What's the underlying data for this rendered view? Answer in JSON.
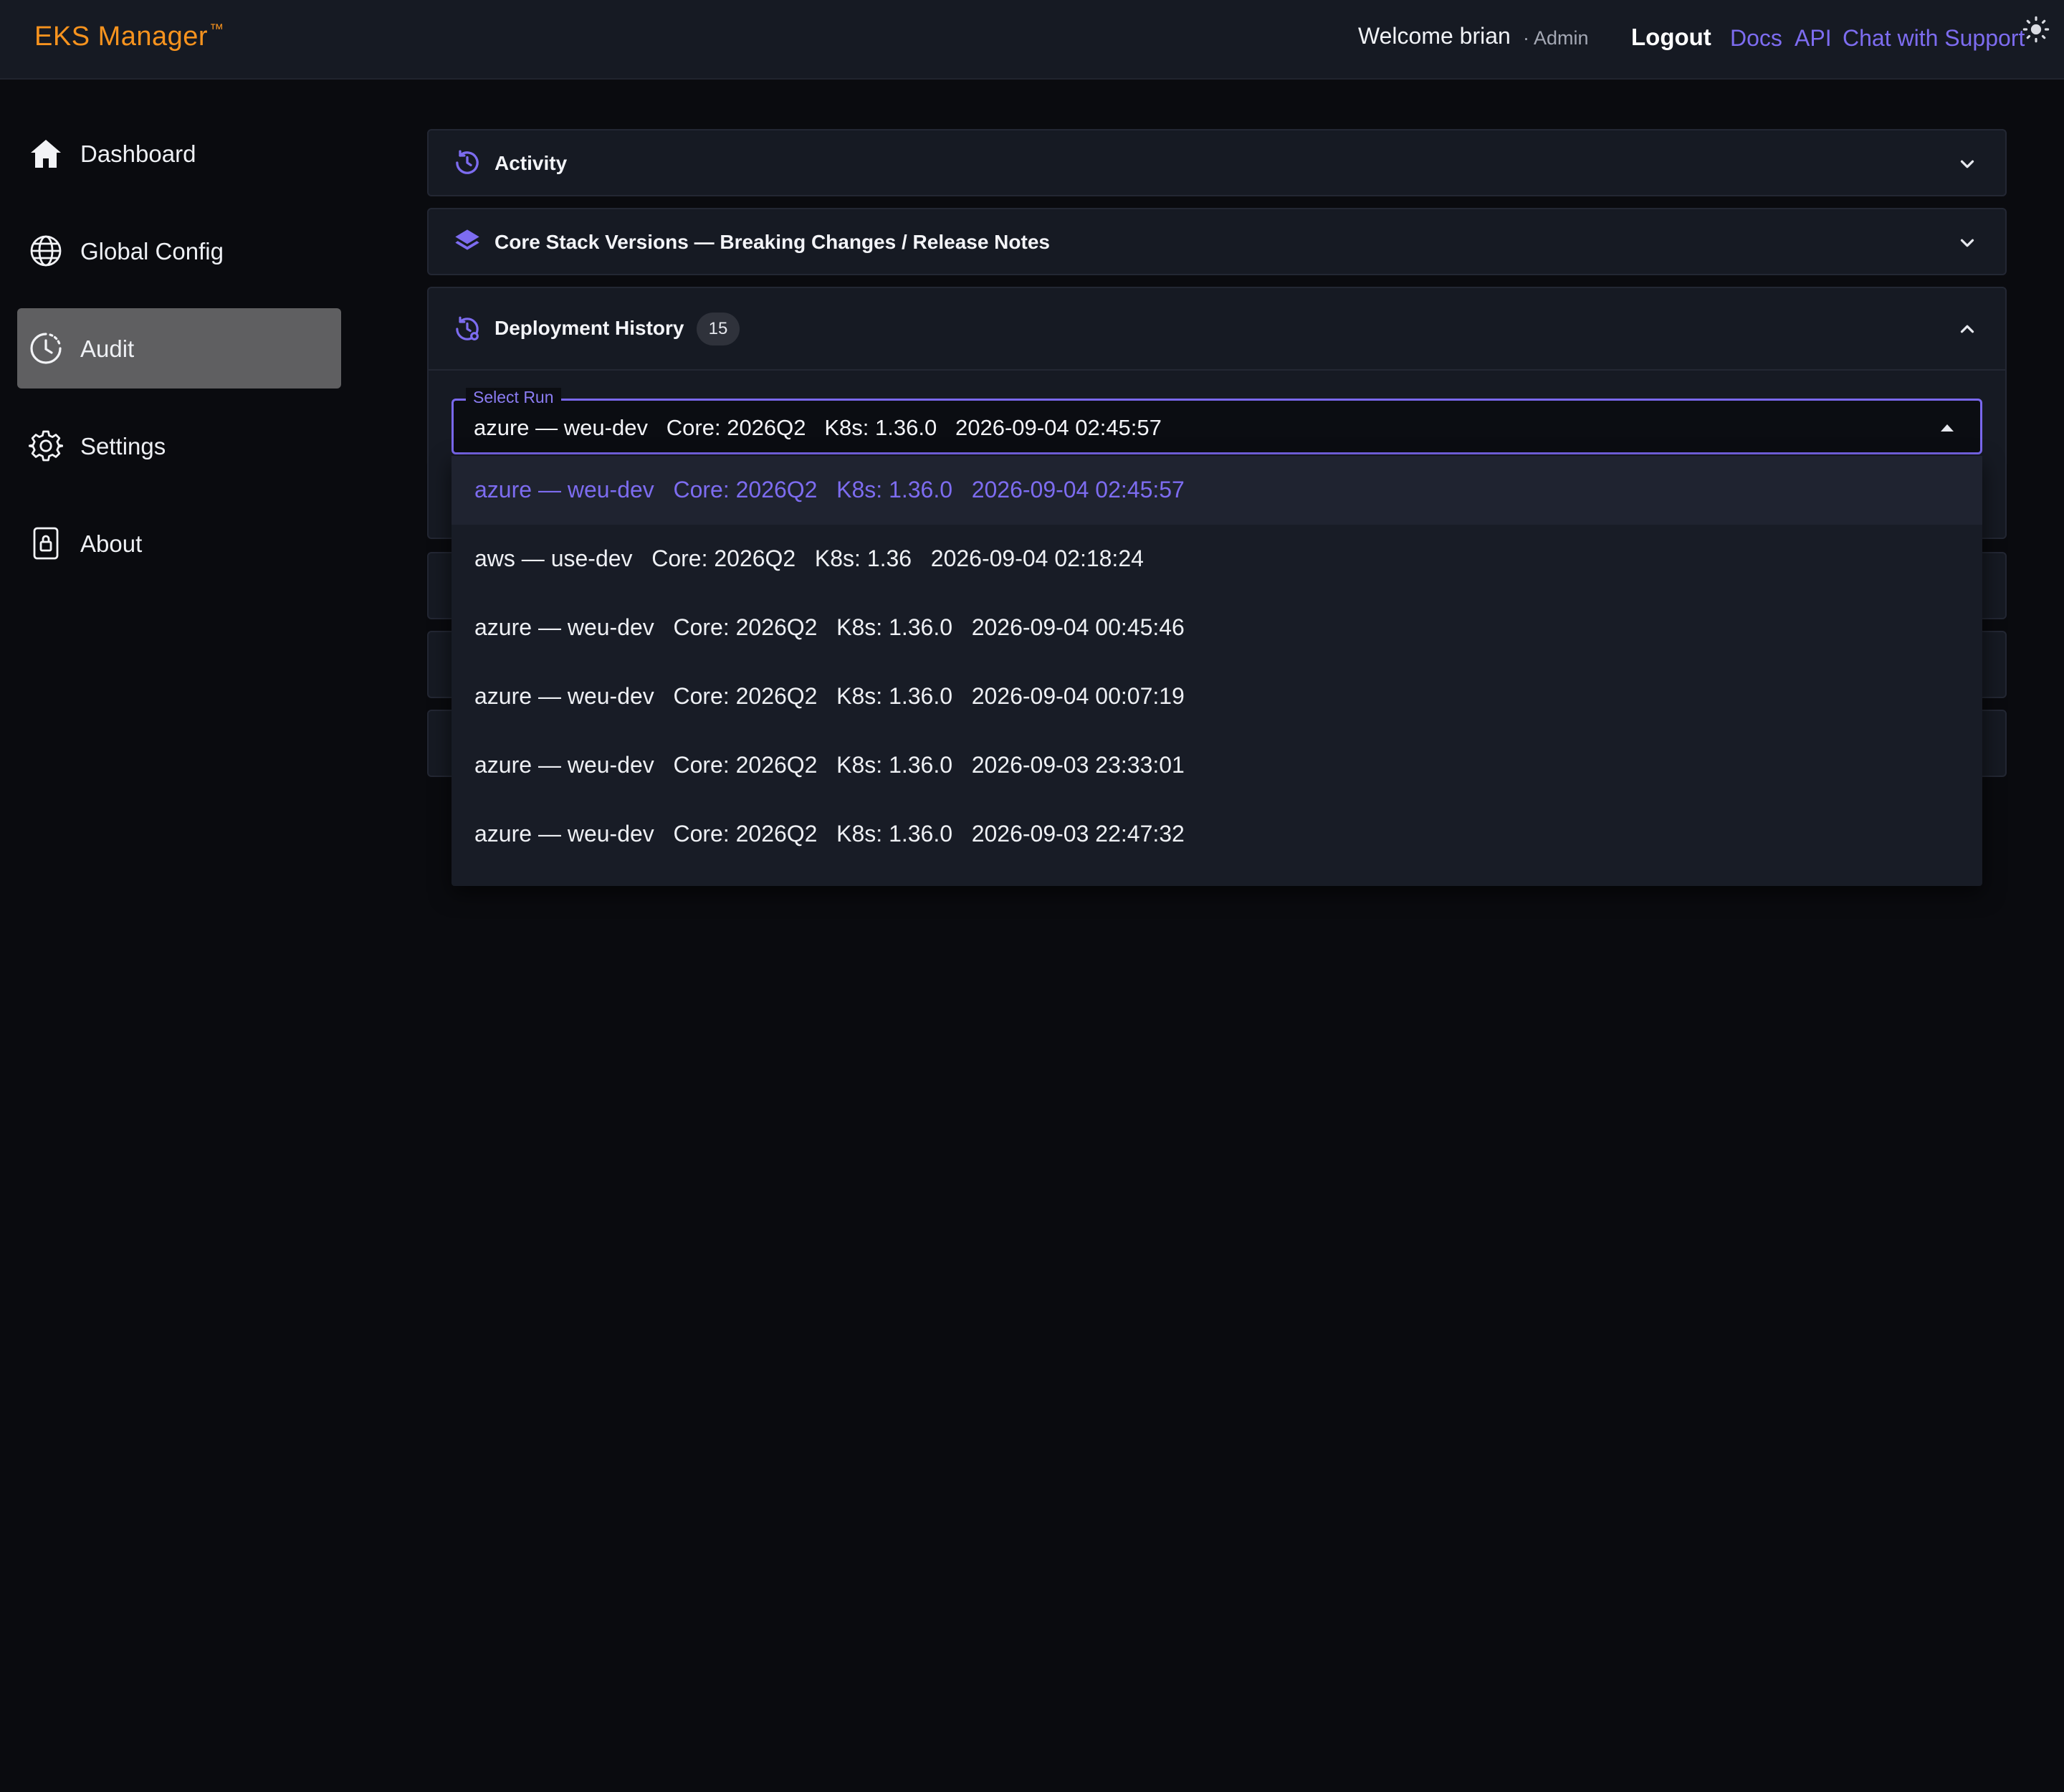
{
  "header": {
    "brand": "EKS Manager",
    "brand_mark": "™",
    "welcome": "Welcome brian",
    "role": "· Admin",
    "logout_label": "Logout",
    "links": {
      "docs": "Docs",
      "api": "API",
      "chat": "Chat with Support"
    },
    "theme_icon": "sun-icon",
    "colors": {
      "brand": "#f7931e",
      "link": "#7d6cf0"
    }
  },
  "sidebar": {
    "items": [
      {
        "label": "Dashboard",
        "icon": "home-icon",
        "active": false
      },
      {
        "label": "Global Config",
        "icon": "globe-icon",
        "active": false
      },
      {
        "label": "Audit",
        "icon": "clock-icon",
        "active": true
      },
      {
        "label": "Settings",
        "icon": "gear-icon",
        "active": false
      },
      {
        "label": "About",
        "icon": "lock-icon",
        "active": false
      }
    ]
  },
  "panels": {
    "activity": {
      "title": "Activity",
      "icon": "history-icon",
      "expanded": false
    },
    "core_stack": {
      "title": "Core Stack Versions — Breaking Changes / Release Notes",
      "icon": "layers-icon",
      "expanded": false
    },
    "deployment_history": {
      "title": "Deployment History",
      "count": "15",
      "icon": "history-gear-icon",
      "expanded": true
    }
  },
  "select_run": {
    "label": "Select Run",
    "value": "azure — weu-dev   Core: 2026Q2   K8s: 1.36.0   2026-09-04 02:45:57",
    "options": [
      {
        "text": "azure — weu-dev   Core: 2026Q2   K8s: 1.36.0   2026-09-04 02:45:57",
        "selected": true
      },
      {
        "text": "aws — use-dev   Core: 2026Q2   K8s: 1.36   2026-09-04 02:18:24",
        "selected": false
      },
      {
        "text": "azure — weu-dev   Core: 2026Q2   K8s: 1.36.0   2026-09-04 00:45:46",
        "selected": false
      },
      {
        "text": "azure — weu-dev   Core: 2026Q2   K8s: 1.36.0   2026-09-04 00:07:19",
        "selected": false
      },
      {
        "text": "azure — weu-dev   Core: 2026Q2   K8s: 1.36.0   2026-09-03 23:33:01",
        "selected": false
      },
      {
        "text": "azure — weu-dev   Core: 2026Q2   K8s: 1.36.0   2026-09-03 22:47:32",
        "selected": false
      }
    ],
    "accent_color": "#7a68ee"
  }
}
